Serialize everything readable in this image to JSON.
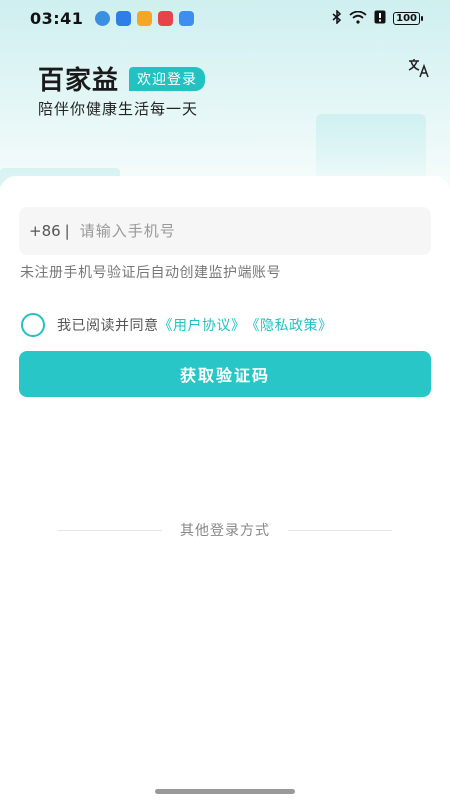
{
  "status_bar": {
    "time": "03:41",
    "battery": "100",
    "icons": [
      "cloud-app-icon",
      "blue-app-icon",
      "orange-app-icon",
      "red-shop-app-icon",
      "message-app-icon",
      "bluetooth-icon",
      "wifi-icon",
      "alert-icon",
      "battery-icon"
    ]
  },
  "header": {
    "brand_name": "百家益",
    "welcome_badge": "欢迎登录",
    "slogan": "陪伴你健康生活每一天"
  },
  "form": {
    "country_code": "+86",
    "divider": "|",
    "phone_placeholder": "请输入手机号",
    "phone_value": "",
    "hint": "未注册手机号验证后自动创建监护端账号",
    "agree_text": "我已阅读并同意",
    "user_agreement": "《用户协议》",
    "privacy_policy": "《隐私政策》",
    "get_code_button": "获取验证码"
  },
  "other_login": {
    "label": "其他登录方式"
  },
  "colors": {
    "accent": "#28c6c6",
    "background_top": "#cfeff0"
  }
}
